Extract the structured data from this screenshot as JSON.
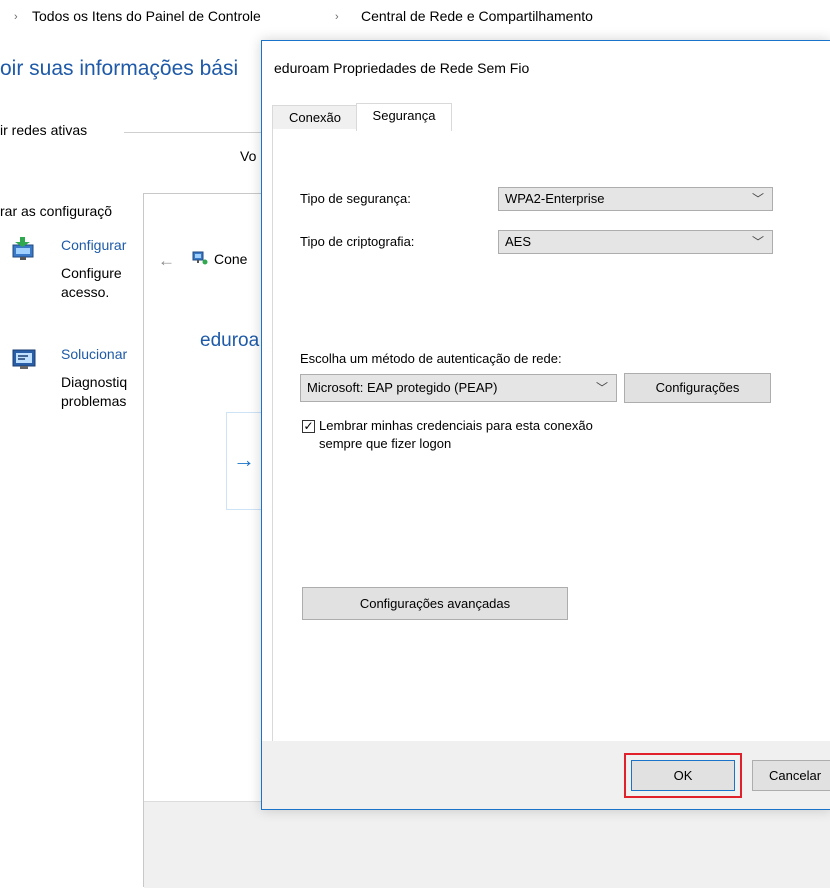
{
  "breadcrumb": {
    "separator": "›",
    "items": [
      "Todos os Itens do Painel de Controle",
      "Central de Rede e Compartilhamento"
    ]
  },
  "background": {
    "title": "oir suas informações bási",
    "active_networks_label": "ir redes ativas",
    "voc_text": "Vo",
    "change_settings_label": "rar as configuraçõ",
    "items": [
      {
        "icon": "network-setup-icon",
        "link": "Configurar",
        "desc_lines": [
          "Configure",
          "acesso."
        ]
      },
      {
        "icon": "troubleshoot-icon",
        "link": "Solucionar",
        "desc_lines": [
          "Diagnostiq",
          "problemas"
        ]
      }
    ]
  },
  "wizard": {
    "back_arrow": "←",
    "title_snippet": "Cone",
    "heading_snippet": "eduroa",
    "arrow": "→"
  },
  "dialog": {
    "title": "eduroam Propriedades de Rede Sem Fio",
    "tabs": [
      {
        "label": "Conexão",
        "active": false
      },
      {
        "label": "Segurança",
        "active": true
      }
    ],
    "security_type_label": "Tipo de segurança:",
    "security_type_value": "WPA2-Enterprise",
    "encryption_type_label": "Tipo de criptografia:",
    "encryption_type_value": "AES",
    "auth_method_label": "Escolha um método de autenticação de rede:",
    "auth_method_value": "Microsoft: EAP protegido (PEAP)",
    "settings_button": "Configurações",
    "remember_checkbox_checked": true,
    "remember_label_line1": "Lembrar minhas credenciais para esta conexão",
    "remember_label_line2": "sempre que fizer logon",
    "advanced_button": "Configurações avançadas",
    "ok_button": "OK",
    "cancel_button": "Cancelar",
    "ok_highlight_color": "#e0202a",
    "accent_color": "#1a73c8"
  }
}
